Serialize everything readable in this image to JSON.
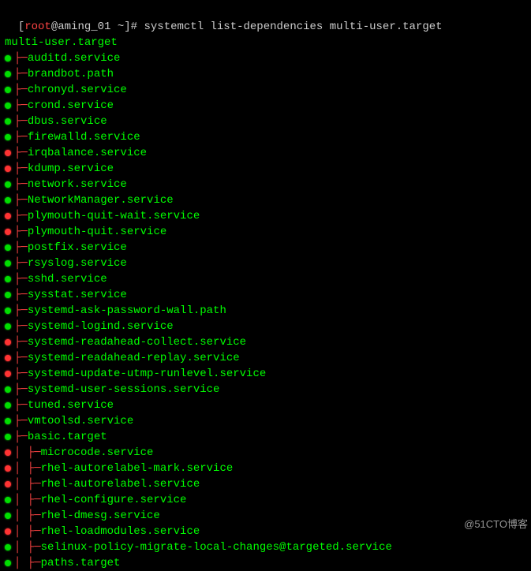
{
  "prompt": {
    "open_bracket": "[",
    "user": "root",
    "at": "@",
    "host": "aming_01",
    "cwd": " ~",
    "close_bracket": "]",
    "symbol": "# ",
    "command": "systemctl list-dependencies multi-user.target"
  },
  "target_title": "multi-user.target",
  "deps": [
    {
      "status": "green",
      "depth": 0,
      "branch": "mid",
      "name": "auditd.service"
    },
    {
      "status": "green",
      "depth": 0,
      "branch": "mid",
      "name": "brandbot.path"
    },
    {
      "status": "green",
      "depth": 0,
      "branch": "mid",
      "name": "chronyd.service"
    },
    {
      "status": "green",
      "depth": 0,
      "branch": "mid",
      "name": "crond.service"
    },
    {
      "status": "green",
      "depth": 0,
      "branch": "mid",
      "name": "dbus.service"
    },
    {
      "status": "green",
      "depth": 0,
      "branch": "mid",
      "name": "firewalld.service"
    },
    {
      "status": "red",
      "depth": 0,
      "branch": "mid",
      "name": "irqbalance.service"
    },
    {
      "status": "red",
      "depth": 0,
      "branch": "mid",
      "name": "kdump.service"
    },
    {
      "status": "green",
      "depth": 0,
      "branch": "mid",
      "name": "network.service"
    },
    {
      "status": "green",
      "depth": 0,
      "branch": "mid",
      "name": "NetworkManager.service"
    },
    {
      "status": "red",
      "depth": 0,
      "branch": "mid",
      "name": "plymouth-quit-wait.service"
    },
    {
      "status": "red",
      "depth": 0,
      "branch": "mid",
      "name": "plymouth-quit.service"
    },
    {
      "status": "green",
      "depth": 0,
      "branch": "mid",
      "name": "postfix.service"
    },
    {
      "status": "green",
      "depth": 0,
      "branch": "mid",
      "name": "rsyslog.service"
    },
    {
      "status": "green",
      "depth": 0,
      "branch": "mid",
      "name": "sshd.service"
    },
    {
      "status": "green",
      "depth": 0,
      "branch": "mid",
      "name": "sysstat.service"
    },
    {
      "status": "green",
      "depth": 0,
      "branch": "mid",
      "name": "systemd-ask-password-wall.path"
    },
    {
      "status": "green",
      "depth": 0,
      "branch": "mid",
      "name": "systemd-logind.service"
    },
    {
      "status": "red",
      "depth": 0,
      "branch": "mid",
      "name": "systemd-readahead-collect.service"
    },
    {
      "status": "red",
      "depth": 0,
      "branch": "mid",
      "name": "systemd-readahead-replay.service"
    },
    {
      "status": "red",
      "depth": 0,
      "branch": "mid",
      "name": "systemd-update-utmp-runlevel.service"
    },
    {
      "status": "green",
      "depth": 0,
      "branch": "mid",
      "name": "systemd-user-sessions.service"
    },
    {
      "status": "green",
      "depth": 0,
      "branch": "mid",
      "name": "tuned.service"
    },
    {
      "status": "green",
      "depth": 0,
      "branch": "mid",
      "name": "vmtoolsd.service"
    },
    {
      "status": "green",
      "depth": 0,
      "branch": "mid",
      "name": "basic.target"
    },
    {
      "status": "red",
      "depth": 1,
      "branch": "mid",
      "name": "microcode.service"
    },
    {
      "status": "red",
      "depth": 1,
      "branch": "mid",
      "name": "rhel-autorelabel-mark.service"
    },
    {
      "status": "red",
      "depth": 1,
      "branch": "mid",
      "name": "rhel-autorelabel.service"
    },
    {
      "status": "green",
      "depth": 1,
      "branch": "mid",
      "name": "rhel-configure.service"
    },
    {
      "status": "green",
      "depth": 1,
      "branch": "mid",
      "name": "rhel-dmesg.service"
    },
    {
      "status": "red",
      "depth": 1,
      "branch": "mid",
      "name": "rhel-loadmodules.service"
    },
    {
      "status": "green",
      "depth": 1,
      "branch": "mid",
      "name": "selinux-policy-migrate-local-changes@targeted.service"
    },
    {
      "status": "green",
      "depth": 1,
      "branch": "mid",
      "name": "paths.target"
    }
  ],
  "tree_glyphs": {
    "pipe": "│ ",
    "mid": "├─",
    "last": "└─"
  },
  "watermark": "@51CTO博客"
}
